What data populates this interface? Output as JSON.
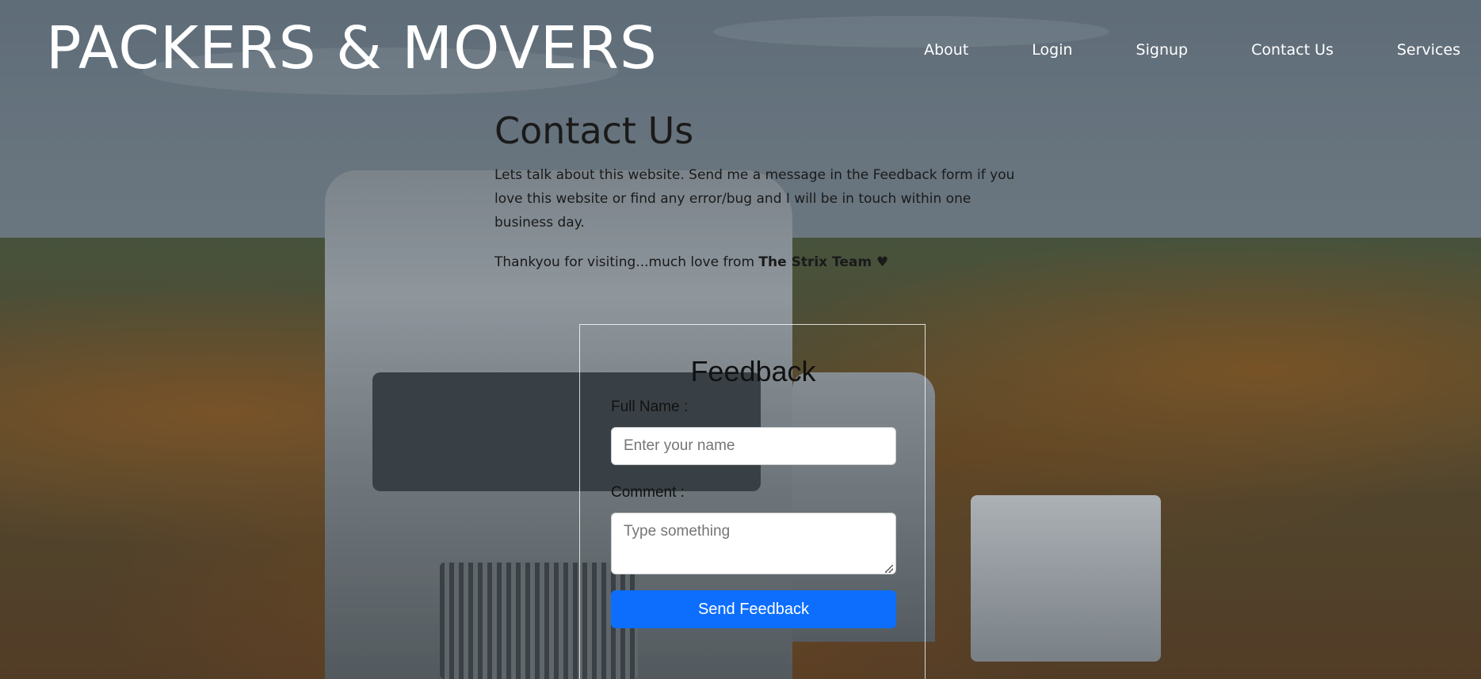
{
  "header": {
    "logo": "PACKERS & MOVERS",
    "nav": [
      "About",
      "Login",
      "Signup",
      "Contact Us",
      "Services"
    ]
  },
  "contact": {
    "title": "Contact Us",
    "description": "Lets talk about this website. Send me a message in the Feedback form if you love this website or find any error/bug and I will be in touch within one business day.",
    "thanks_prefix": "Thankyou for visiting...much love from ",
    "thanks_team": "The Strix Team ♥"
  },
  "feedback": {
    "title": "Feedback",
    "name_label": "Full Name :",
    "name_placeholder": "Enter your name",
    "comment_label": "Comment :",
    "comment_placeholder": "Type something",
    "submit_label": "Send Feedback"
  },
  "colors": {
    "primary_button": "#0d6efd",
    "header_text": "#ffffff"
  }
}
